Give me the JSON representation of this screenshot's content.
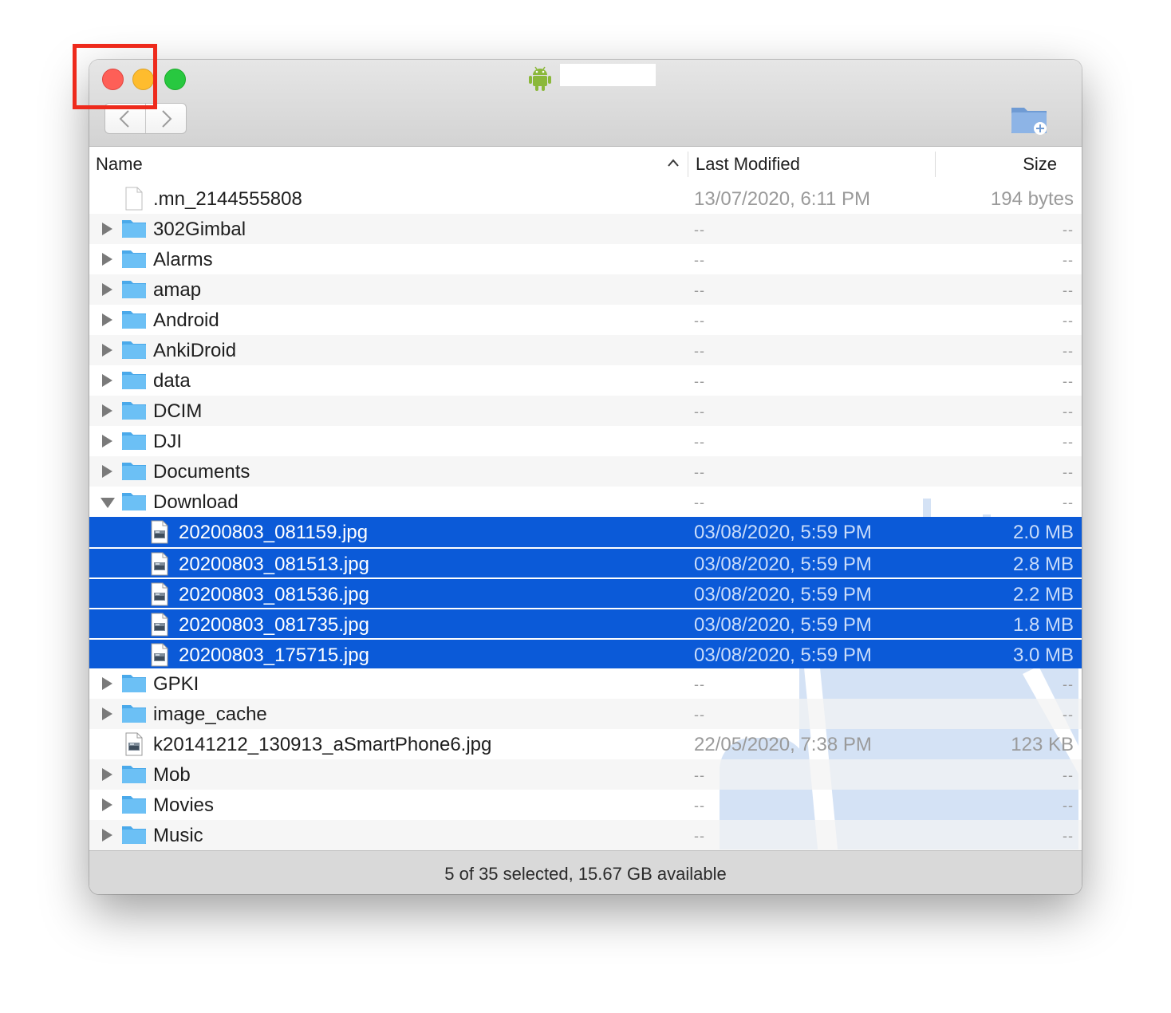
{
  "window": {
    "title_icon": "android-icon"
  },
  "toolbar": {
    "back_icon": "chevron-left-icon",
    "forward_icon": "chevron-right-icon",
    "new_folder_icon": "new-folder-icon"
  },
  "columns": {
    "name": "Name",
    "modified": "Last Modified",
    "size": "Size",
    "sort_icon": "chevron-up-icon"
  },
  "rows": [
    {
      "name": ".mn_2144555808",
      "modified": "13/07/2020, 6:11 PM",
      "size": "194 bytes",
      "kind": "file",
      "level": 0,
      "selected": false
    },
    {
      "name": "302Gimbal",
      "modified": "--",
      "size": "--",
      "kind": "folder",
      "level": 0,
      "selected": false
    },
    {
      "name": "Alarms",
      "modified": "--",
      "size": "--",
      "kind": "folder",
      "level": 0,
      "selected": false
    },
    {
      "name": "amap",
      "modified": "--",
      "size": "--",
      "kind": "folder",
      "level": 0,
      "selected": false
    },
    {
      "name": "Android",
      "modified": "--",
      "size": "--",
      "kind": "folder",
      "level": 0,
      "selected": false
    },
    {
      "name": "AnkiDroid",
      "modified": "--",
      "size": "--",
      "kind": "folder",
      "level": 0,
      "selected": false
    },
    {
      "name": "data",
      "modified": "--",
      "size": "--",
      "kind": "folder",
      "level": 0,
      "selected": false
    },
    {
      "name": "DCIM",
      "modified": "--",
      "size": "--",
      "kind": "folder",
      "level": 0,
      "selected": false
    },
    {
      "name": "DJI",
      "modified": "--",
      "size": "--",
      "kind": "folder",
      "level": 0,
      "selected": false
    },
    {
      "name": "Documents",
      "modified": "--",
      "size": "--",
      "kind": "folder",
      "level": 0,
      "selected": false
    },
    {
      "name": "Download",
      "modified": "--",
      "size": "--",
      "kind": "folder",
      "level": 0,
      "selected": false,
      "expanded": true
    },
    {
      "name": "20200803_081159.jpg",
      "modified": "03/08/2020, 5:59 PM",
      "size": "2.0 MB",
      "kind": "image",
      "level": 1,
      "selected": true
    },
    {
      "name": "20200803_081513.jpg",
      "modified": "03/08/2020, 5:59 PM",
      "size": "2.8 MB",
      "kind": "image",
      "level": 1,
      "selected": true
    },
    {
      "name": "20200803_081536.jpg",
      "modified": "03/08/2020, 5:59 PM",
      "size": "2.2 MB",
      "kind": "image",
      "level": 1,
      "selected": true
    },
    {
      "name": "20200803_081735.jpg",
      "modified": "03/08/2020, 5:59 PM",
      "size": "1.8 MB",
      "kind": "image",
      "level": 1,
      "selected": true
    },
    {
      "name": "20200803_175715.jpg",
      "modified": "03/08/2020, 5:59 PM",
      "size": "3.0 MB",
      "kind": "image",
      "level": 1,
      "selected": true
    },
    {
      "name": "GPKI",
      "modified": "--",
      "size": "--",
      "kind": "folder",
      "level": 0,
      "selected": false
    },
    {
      "name": "image_cache",
      "modified": "--",
      "size": "--",
      "kind": "folder",
      "level": 0,
      "selected": false
    },
    {
      "name": "k20141212_130913_aSmartPhone6.jpg",
      "modified": "22/05/2020, 7:38 PM",
      "size": "123 KB",
      "kind": "image",
      "level": 0,
      "selected": false
    },
    {
      "name": "Mob",
      "modified": "--",
      "size": "--",
      "kind": "folder",
      "level": 0,
      "selected": false
    },
    {
      "name": "Movies",
      "modified": "--",
      "size": "--",
      "kind": "folder",
      "level": 0,
      "selected": false
    },
    {
      "name": "Music",
      "modified": "--",
      "size": "--",
      "kind": "folder",
      "level": 0,
      "selected": false
    }
  ],
  "status": {
    "text": "5 of 35 selected, 15.67 GB available"
  },
  "colors": {
    "selection": "#0b5ad8",
    "folder": "#5fb8f2",
    "close": "#fe5f57",
    "minimize": "#febc2e",
    "zoom": "#28c840",
    "annotation": "#ee2a1c"
  }
}
